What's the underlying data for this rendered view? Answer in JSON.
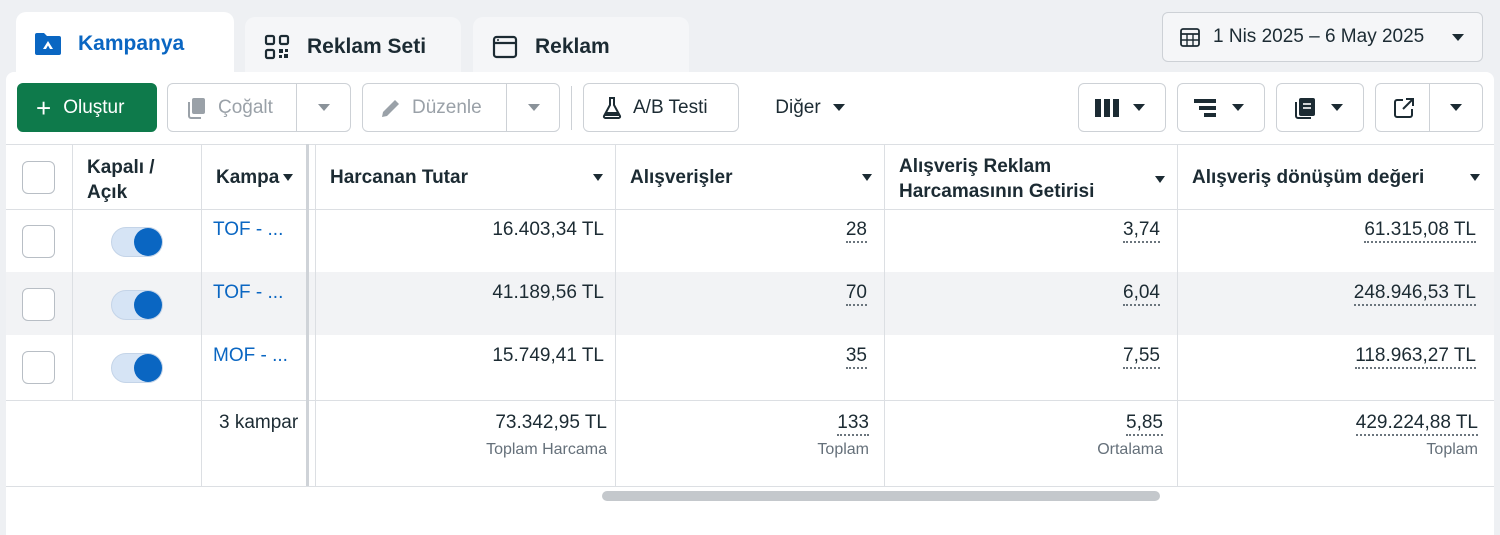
{
  "tabs": [
    {
      "label": "Kampanya",
      "icon": "folder-icon"
    },
    {
      "label": "Reklam Seti",
      "icon": "grid-icon"
    },
    {
      "label": "Reklam",
      "icon": "window-icon"
    }
  ],
  "date_range": {
    "label": "1 Nis 2025 – 6 May 2025",
    "icon": "calendar-icon"
  },
  "toolbar": {
    "create_label": "Oluştur",
    "duplicate_label": "Çoğalt",
    "edit_label": "Düzenle",
    "ab_test_label": "A/B Testi",
    "more_label": "Diğer"
  },
  "table": {
    "headers": {
      "onoff": "Kapalı / Açık",
      "campaign": "Kampa",
      "spend": "Harcanan Tutar",
      "purchases": "Alışverişler",
      "roas_line1": "Alışveriş Reklam",
      "roas_line2": "Harcamasının Getirisi",
      "conv_value": "Alışveriş dönüşüm değeri"
    },
    "rows": [
      {
        "campaign": "TOF - ...",
        "spend": "16.403,34 TL",
        "purchases": "28",
        "roas": "3,74",
        "conv_value": "61.315,08 TL",
        "on": true
      },
      {
        "campaign": "TOF - ...",
        "spend": "41.189,56 TL",
        "purchases": "70",
        "roas": "6,04",
        "conv_value": "248.946,53 TL",
        "on": true
      },
      {
        "campaign": "MOF - ...",
        "spend": "15.749,41 TL",
        "purchases": "35",
        "roas": "7,55",
        "conv_value": "118.963,27 TL",
        "on": true
      }
    ],
    "totals": {
      "campaign_count": "3 kampar",
      "spend": "73.342,95 TL",
      "spend_label": "Toplam Harcama",
      "purchases": "133",
      "purchases_label": "Toplam",
      "roas": "5,85",
      "roas_label": "Ortalama",
      "conv_value": "429.224,88 TL",
      "conv_value_label": "Toplam"
    }
  },
  "colors": {
    "accent": "#0a66c2",
    "create": "#0e7a4b"
  }
}
